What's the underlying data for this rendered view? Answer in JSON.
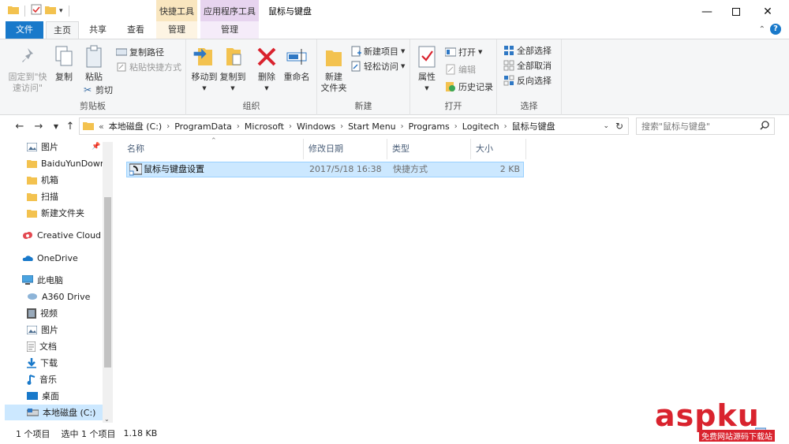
{
  "titlebar": {
    "title": "鼠标与键盘",
    "context_tab_shortcut": "快捷工具",
    "context_tab_app": "应用程序工具"
  },
  "tabs": {
    "file": "文件",
    "home": "主页",
    "share": "共享",
    "view": "查看",
    "manage1": "管理",
    "manage2": "管理",
    "help": "?"
  },
  "ribbon": {
    "clipboard": {
      "pin_line1": "固定到\"快",
      "pin_line2": "速访问\"",
      "copy": "复制",
      "paste": "粘贴",
      "copy_path": "复制路径",
      "paste_shortcut": "粘贴快捷方式",
      "cut": "剪切",
      "label": "剪贴板"
    },
    "organize": {
      "move_to": "移动到",
      "copy_to": "复制到",
      "delete": "删除",
      "rename": "重命名",
      "label": "组织"
    },
    "new": {
      "new_folder_line1": "新建",
      "new_folder_line2": "文件夹",
      "new_item": "新建项目",
      "easy_access": "轻松访问",
      "label": "新建"
    },
    "open": {
      "properties": "属性",
      "open": "打开",
      "edit": "编辑",
      "history": "历史记录",
      "label": "打开"
    },
    "select": {
      "select_all": "全部选择",
      "select_none": "全部取消",
      "invert": "反向选择",
      "label": "选择"
    }
  },
  "address": {
    "overflow": "«",
    "crumbs": [
      "本地磁盘 (C:)",
      "ProgramData",
      "Microsoft",
      "Windows",
      "Start Menu",
      "Programs",
      "Logitech",
      "鼠标与键盘"
    ],
    "search_placeholder": "搜索\"鼠标与键盘\""
  },
  "navpane": {
    "items": [
      {
        "label": "图片",
        "icon": "pictures-icon"
      },
      {
        "label": "BaiduYunDown",
        "icon": "folder-icon"
      },
      {
        "label": "机箱",
        "icon": "folder-icon"
      },
      {
        "label": "扫描",
        "icon": "folder-icon"
      },
      {
        "label": "新建文件夹",
        "icon": "folder-icon"
      },
      {
        "label": "Creative Cloud F",
        "icon": "creative-cloud-icon"
      },
      {
        "label": "OneDrive",
        "icon": "onedrive-icon"
      },
      {
        "label": "此电脑",
        "icon": "this-pc-icon"
      },
      {
        "label": "A360 Drive",
        "icon": "a360-icon"
      },
      {
        "label": "视频",
        "icon": "videos-icon"
      },
      {
        "label": "图片",
        "icon": "pictures-icon"
      },
      {
        "label": "文档",
        "icon": "documents-icon"
      },
      {
        "label": "下载",
        "icon": "downloads-icon"
      },
      {
        "label": "音乐",
        "icon": "music-icon"
      },
      {
        "label": "桌面",
        "icon": "desktop-icon"
      },
      {
        "label": "本地磁盘 (C:)",
        "icon": "drive-icon"
      }
    ]
  },
  "filelist": {
    "columns": {
      "name": "名称",
      "modified": "修改日期",
      "type": "类型",
      "size": "大小"
    },
    "rows": [
      {
        "name": "鼠标与键盘设置",
        "modified": "2017/5/18 16:38",
        "type": "快捷方式",
        "size": "2 KB"
      }
    ]
  },
  "status": {
    "count": "1 个项目",
    "selected": "选中 1 个项目",
    "size": "1.18 KB"
  },
  "watermark": {
    "main": "aspku",
    "sub": "免费网站源码下载站"
  },
  "colors": {
    "file_tab": "#1979ca",
    "selection": "#cce8ff",
    "shortcut_tools": "#f9e6bf",
    "app_tools": "#e7d4ef",
    "watermark": "#d9232e"
  }
}
